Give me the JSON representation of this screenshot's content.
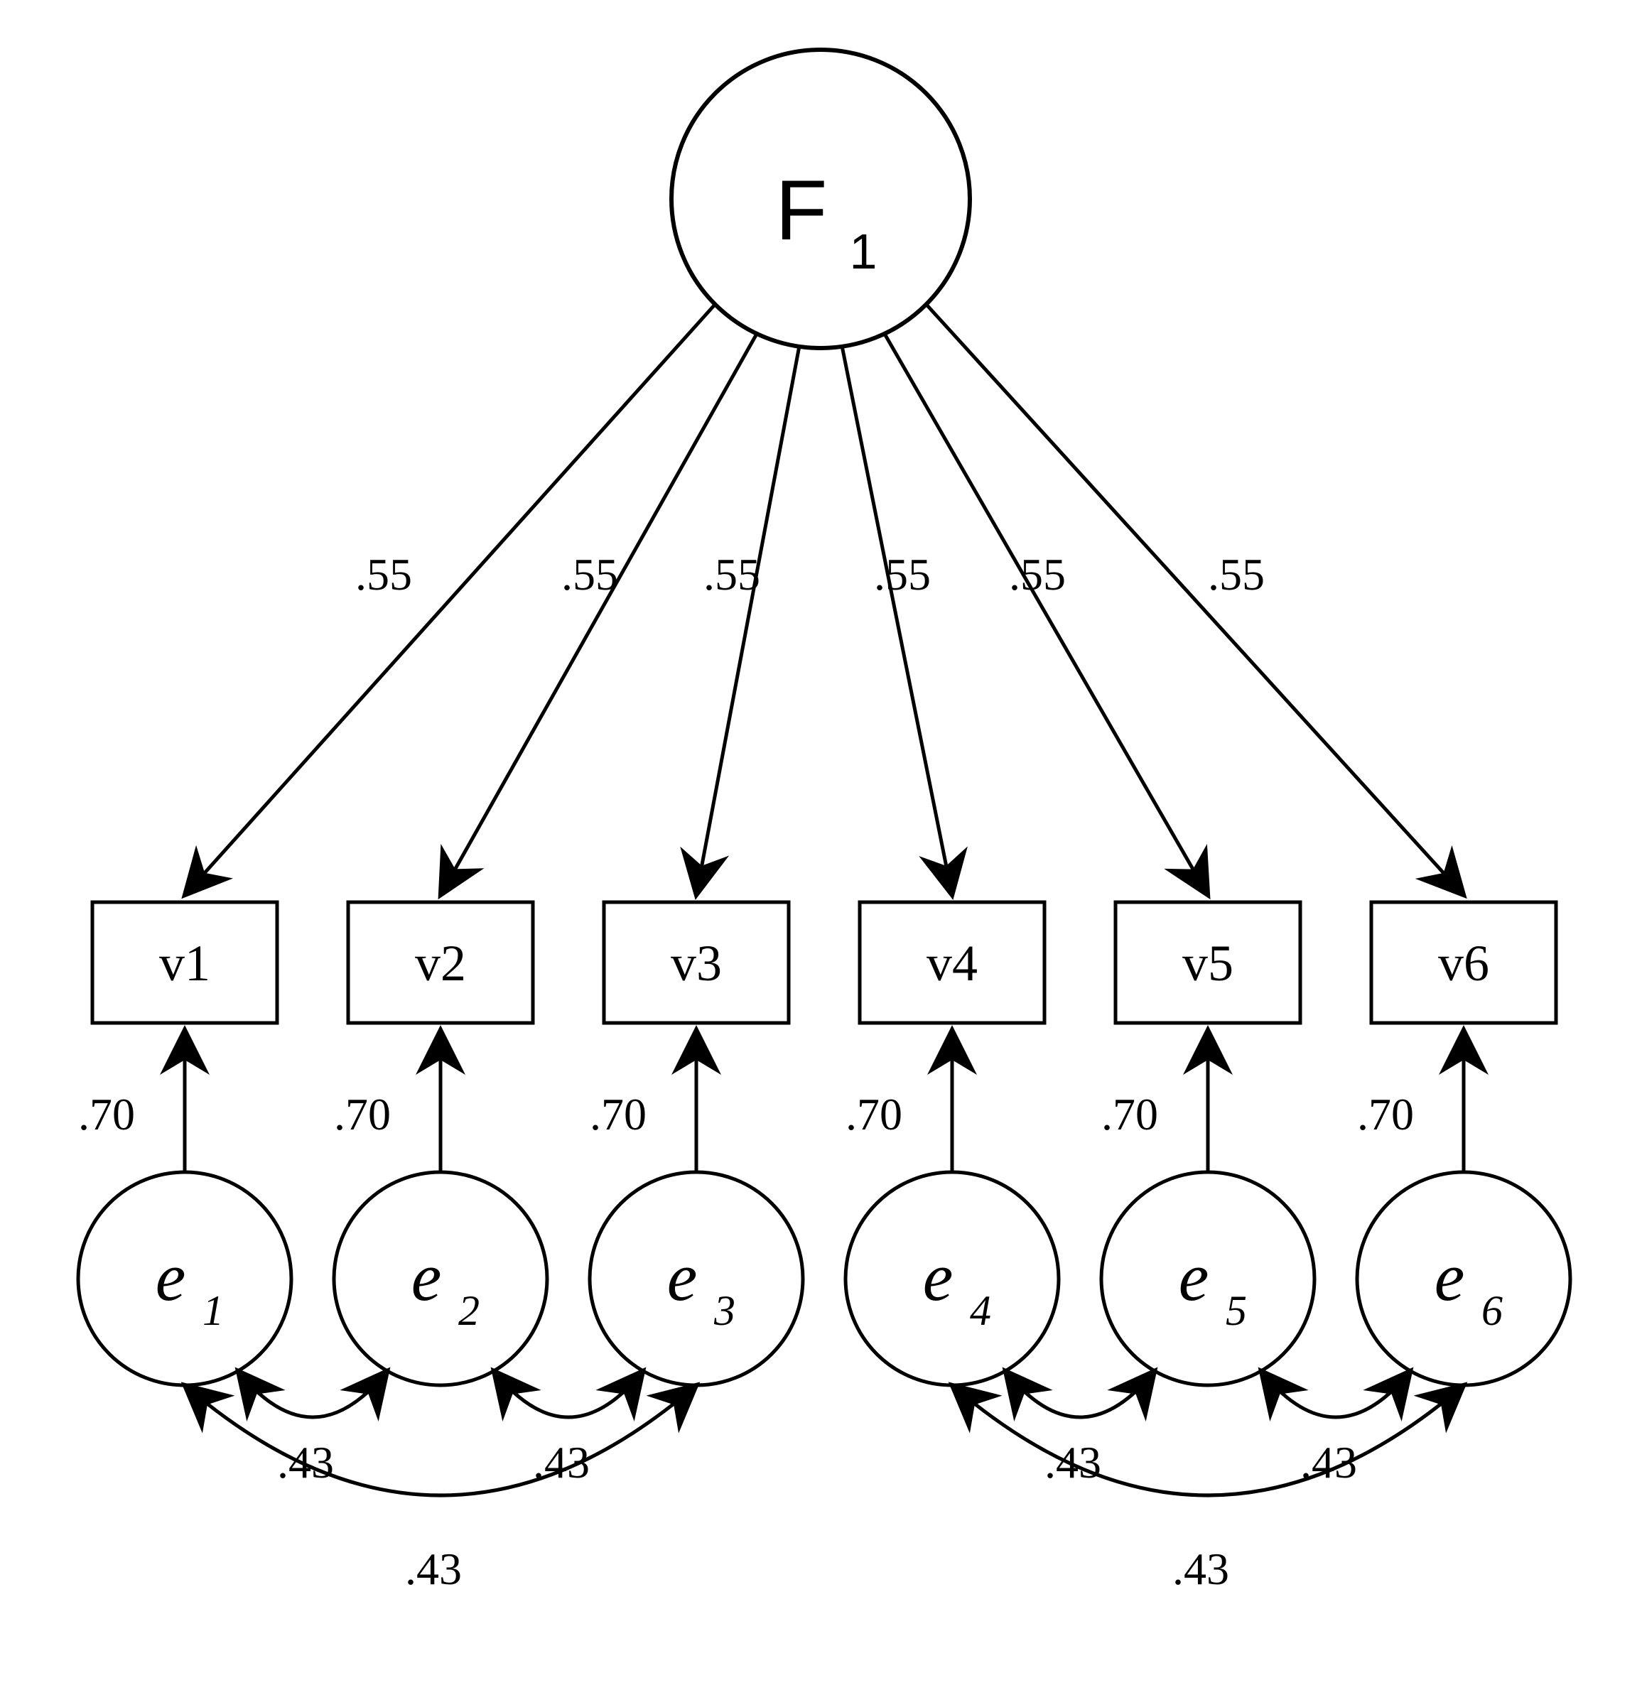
{
  "factor": {
    "label_main": "F",
    "label_sub": "1"
  },
  "observed": [
    {
      "id": "v1",
      "label": "v1",
      "loading": ".55"
    },
    {
      "id": "v2",
      "label": "v2",
      "loading": ".55"
    },
    {
      "id": "v3",
      "label": "v3",
      "loading": ".55"
    },
    {
      "id": "v4",
      "label": "v4",
      "loading": ".55"
    },
    {
      "id": "v5",
      "label": "v5",
      "loading": ".55"
    },
    {
      "id": "v6",
      "label": "v6",
      "loading": ".55"
    }
  ],
  "errors": [
    {
      "id": "e1",
      "main": "e",
      "sub": "1",
      "variance": ".70"
    },
    {
      "id": "e2",
      "main": "e",
      "sub": "2",
      "variance": ".70"
    },
    {
      "id": "e3",
      "main": "e",
      "sub": "3",
      "variance": ".70"
    },
    {
      "id": "e4",
      "main": "e",
      "sub": "4",
      "variance": ".70"
    },
    {
      "id": "e5",
      "main": "e",
      "sub": "5",
      "variance": ".70"
    },
    {
      "id": "e6",
      "main": "e",
      "sub": "6",
      "variance": ".70"
    }
  ],
  "covariances": [
    {
      "between": [
        "e1",
        "e2"
      ],
      "value": ".43"
    },
    {
      "between": [
        "e2",
        "e3"
      ],
      "value": ".43"
    },
    {
      "between": [
        "e1",
        "e3"
      ],
      "value": ".43"
    },
    {
      "between": [
        "e4",
        "e5"
      ],
      "value": ".43"
    },
    {
      "between": [
        "e5",
        "e6"
      ],
      "value": ".43"
    },
    {
      "between": [
        "e4",
        "e6"
      ],
      "value": ".43"
    }
  ],
  "chart_data": {
    "type": "path-diagram",
    "title": "",
    "latent_factors": [
      "F1"
    ],
    "observed_variables": [
      "v1",
      "v2",
      "v3",
      "v4",
      "v5",
      "v6"
    ],
    "loadings": {
      "v1": 0.55,
      "v2": 0.55,
      "v3": 0.55,
      "v4": 0.55,
      "v5": 0.55,
      "v6": 0.55
    },
    "error_variances": {
      "e1": 0.7,
      "e2": 0.7,
      "e3": 0.7,
      "e4": 0.7,
      "e5": 0.7,
      "e6": 0.7
    },
    "error_covariances": [
      {
        "pair": [
          "e1",
          "e2"
        ],
        "value": 0.43
      },
      {
        "pair": [
          "e2",
          "e3"
        ],
        "value": 0.43
      },
      {
        "pair": [
          "e1",
          "e3"
        ],
        "value": 0.43
      },
      {
        "pair": [
          "e4",
          "e5"
        ],
        "value": 0.43
      },
      {
        "pair": [
          "e5",
          "e6"
        ],
        "value": 0.43
      },
      {
        "pair": [
          "e4",
          "e6"
        ],
        "value": 0.43
      }
    ]
  }
}
